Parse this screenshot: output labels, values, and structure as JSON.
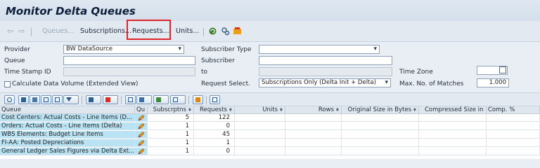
{
  "window": {
    "title": "Monitor Delta Queues"
  },
  "toolbar": {
    "queues_label": "Queues...",
    "subscriptions_label": "Subscriptions...",
    "requests_label": "Requests...",
    "units_label": "Units..."
  },
  "form": {
    "provider_label": "Provider",
    "provider_value": "BW DataSource",
    "subscriber_type_label": "Subscriber Type",
    "subscriber_type_value": "",
    "queue_label": "Queue",
    "queue_value": "",
    "subscriber_label": "Subscriber",
    "subscriber_value": "",
    "timestamp_label": "Time Stamp ID",
    "timestamp_value": "",
    "to_label": "to",
    "to_value": "",
    "time_zone_label": "Time Zone",
    "time_zone_value": "",
    "calc_label": "Calculate Data Volume (Extended View)",
    "calc_checked": false,
    "request_select_label": "Request Select.",
    "request_select_value": "Subscriptions Only (Delta Init + Delta)",
    "max_matches_label": "Max. No. of Matches",
    "max_matches_value": "1.000"
  },
  "grid": {
    "headers": {
      "queue": "Queue",
      "edit": "Qu",
      "subscriptions": "Subscrptns",
      "requests": "Requests",
      "units": "Units",
      "rows": "Rows",
      "orig_size": "Original Size in Bytes",
      "comp_size": "Compressed Size in ...",
      "comp_pct": "Comp. %"
    },
    "rows": [
      {
        "queue": "Cost Centers: Actual Costs - Line Items (D...",
        "subscriptions": "5",
        "requests": "122"
      },
      {
        "queue": "Orders: Actual Costs - Line Items (Delta)",
        "subscriptions": "1",
        "requests": "0"
      },
      {
        "queue": "WBS Elements: Budget Line Items",
        "subscriptions": "1",
        "requests": "45"
      },
      {
        "queue": "FI-AA: Posted Depreciations",
        "subscriptions": "1",
        "requests": "1"
      },
      {
        "queue": "General Ledger Sales Figures via Delta Ext...",
        "subscriptions": "1",
        "requests": "0"
      }
    ]
  },
  "colors": {
    "accent_red": "#e0242a",
    "queue_cell_bg": "#b9e3f2"
  }
}
